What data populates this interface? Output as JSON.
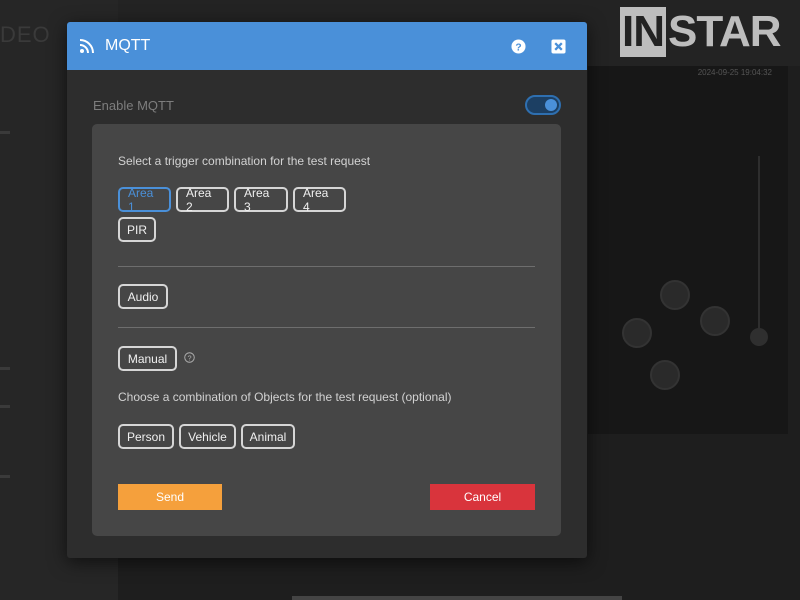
{
  "background": {
    "section_label": "DEO",
    "logo_highlight": "IN",
    "logo_rest": "STAR",
    "timestamp": "2024-09-25 19:04:32"
  },
  "modal": {
    "title": "MQTT",
    "header_color": "#4a90d9",
    "header_icon": "rss-icon",
    "help_icon": "question-icon",
    "close_icon": "close-icon",
    "enable_label": "Enable MQTT",
    "enable_toggle_on": true
  },
  "trigger": {
    "prompt": "Select a trigger combination for the test request",
    "areas": [
      {
        "label": "Area 1",
        "selected": true
      },
      {
        "label": "Area 2",
        "selected": false
      },
      {
        "label": "Area 3",
        "selected": false
      },
      {
        "label": "Area 4",
        "selected": false
      }
    ],
    "pir": "PIR",
    "audio": "Audio",
    "manual": "Manual"
  },
  "objects": {
    "prompt": "Choose a combination of Objects for the test request (optional)",
    "items": [
      "Person",
      "Vehicle",
      "Animal"
    ]
  },
  "actions": {
    "send_label": "Send",
    "send_color": "#f5a03c",
    "cancel_label": "Cancel",
    "cancel_color": "#d9343c"
  }
}
